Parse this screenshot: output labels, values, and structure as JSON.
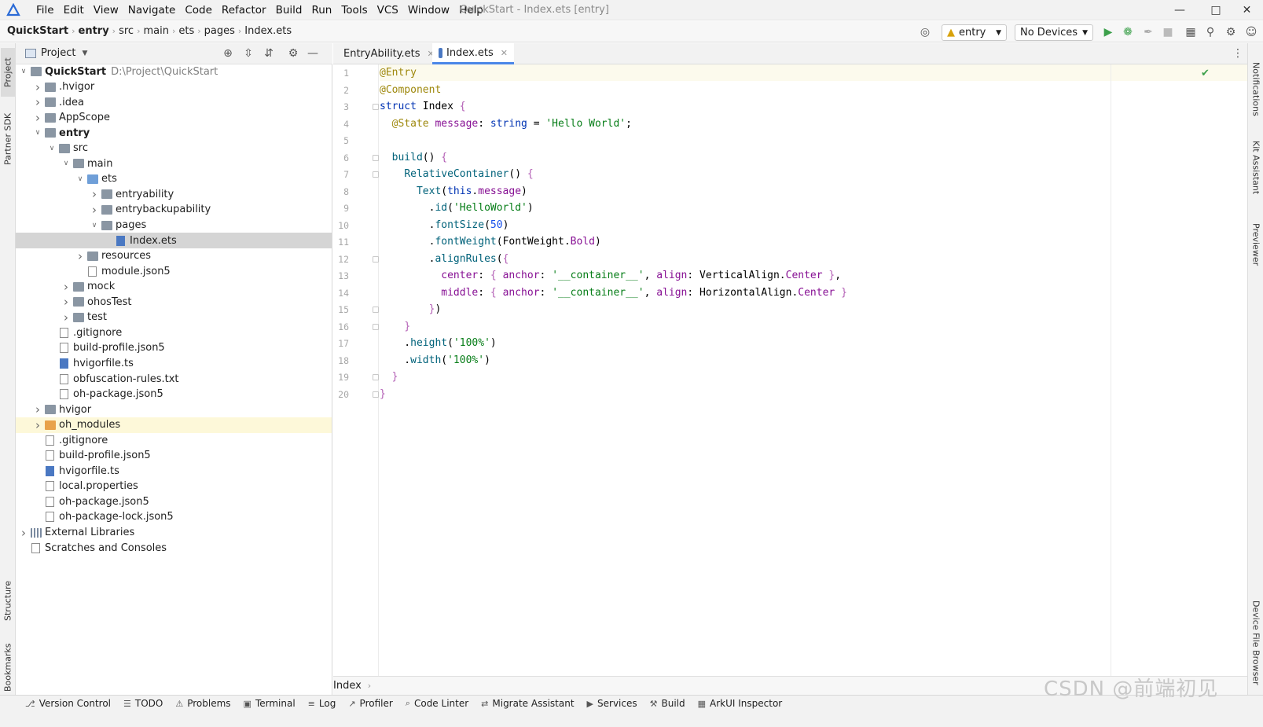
{
  "window": {
    "title": "QuickStart - Index.ets [entry]",
    "menus": [
      "File",
      "Edit",
      "View",
      "Navigate",
      "Code",
      "Refactor",
      "Build",
      "Run",
      "Tools",
      "VCS",
      "Window",
      "Help"
    ]
  },
  "navbar": {
    "crumbs": [
      "QuickStart",
      "entry",
      "src",
      "main",
      "ets",
      "pages",
      "Index.ets"
    ],
    "module_select": "entry",
    "device_select": "No Devices"
  },
  "left_strip": {
    "project": "Project",
    "partner_sdk": "Partner SDK",
    "structure": "Structure",
    "bookmarks": "Bookmarks"
  },
  "right_strip": {
    "notifications": "Notifications",
    "kit_assistant": "Kit Assistant",
    "previewer": "Previewer",
    "device_file_browser": "Device File Browser"
  },
  "project_panel": {
    "title": "Project",
    "root_path": "D:\\Project\\QuickStart",
    "tree": [
      {
        "label": "QuickStart",
        "depth": 0,
        "arrow": "v",
        "icon": "folder",
        "bold": true
      },
      {
        "label": ".hvigor",
        "depth": 1,
        "arrow": ">",
        "icon": "folder"
      },
      {
        "label": ".idea",
        "depth": 1,
        "arrow": ">",
        "icon": "folder"
      },
      {
        "label": "AppScope",
        "depth": 1,
        "arrow": ">",
        "icon": "folder"
      },
      {
        "label": "entry",
        "depth": 1,
        "arrow": "v",
        "icon": "folder",
        "bold": true
      },
      {
        "label": "src",
        "depth": 2,
        "arrow": "v",
        "icon": "folder"
      },
      {
        "label": "main",
        "depth": 3,
        "arrow": "v",
        "icon": "folder"
      },
      {
        "label": "ets",
        "depth": 4,
        "arrow": "v",
        "icon": "folder-blue"
      },
      {
        "label": "entryability",
        "depth": 5,
        "arrow": ">",
        "icon": "folder"
      },
      {
        "label": "entrybackupability",
        "depth": 5,
        "arrow": ">",
        "icon": "folder"
      },
      {
        "label": "pages",
        "depth": 5,
        "arrow": "v",
        "icon": "folder"
      },
      {
        "label": "Index.ets",
        "depth": 6,
        "arrow": "",
        "icon": "ts",
        "selected": true
      },
      {
        "label": "resources",
        "depth": 4,
        "arrow": ">",
        "icon": "folder"
      },
      {
        "label": "module.json5",
        "depth": 4,
        "arrow": "",
        "icon": "file"
      },
      {
        "label": "mock",
        "depth": 3,
        "arrow": ">",
        "icon": "folder"
      },
      {
        "label": "ohosTest",
        "depth": 3,
        "arrow": ">",
        "icon": "folder"
      },
      {
        "label": "test",
        "depth": 3,
        "arrow": ">",
        "icon": "folder"
      },
      {
        "label": ".gitignore",
        "depth": 2,
        "arrow": "",
        "icon": "file"
      },
      {
        "label": "build-profile.json5",
        "depth": 2,
        "arrow": "",
        "icon": "file"
      },
      {
        "label": "hvigorfile.ts",
        "depth": 2,
        "arrow": "",
        "icon": "ts"
      },
      {
        "label": "obfuscation-rules.txt",
        "depth": 2,
        "arrow": "",
        "icon": "file"
      },
      {
        "label": "oh-package.json5",
        "depth": 2,
        "arrow": "",
        "icon": "file"
      },
      {
        "label": "hvigor",
        "depth": 1,
        "arrow": ">",
        "icon": "folder"
      },
      {
        "label": "oh_modules",
        "depth": 1,
        "arrow": ">",
        "icon": "folder-orange",
        "highlight": true
      },
      {
        "label": ".gitignore",
        "depth": 1,
        "arrow": "",
        "icon": "file"
      },
      {
        "label": "build-profile.json5",
        "depth": 1,
        "arrow": "",
        "icon": "file"
      },
      {
        "label": "hvigorfile.ts",
        "depth": 1,
        "arrow": "",
        "icon": "ts"
      },
      {
        "label": "local.properties",
        "depth": 1,
        "arrow": "",
        "icon": "file"
      },
      {
        "label": "oh-package.json5",
        "depth": 1,
        "arrow": "",
        "icon": "file"
      },
      {
        "label": "oh-package-lock.json5",
        "depth": 1,
        "arrow": "",
        "icon": "file"
      },
      {
        "label": "External Libraries",
        "depth": 0,
        "arrow": ">",
        "icon": "lib"
      },
      {
        "label": "Scratches and Consoles",
        "depth": 0,
        "arrow": "",
        "icon": "file"
      }
    ]
  },
  "editor": {
    "tabs": [
      {
        "label": "EntryAbility.ets",
        "active": false
      },
      {
        "label": "Index.ets",
        "active": true
      }
    ],
    "lines": [
      [
        [
          "an",
          "@Entry"
        ]
      ],
      [
        [
          "an",
          "@Component"
        ]
      ],
      [
        [
          "kw",
          "struct "
        ],
        [
          "id",
          "Index "
        ],
        [
          "par",
          "{"
        ]
      ],
      [
        [
          "id",
          "  "
        ],
        [
          "an",
          "@State "
        ],
        [
          "prop",
          "message"
        ],
        [
          "id",
          ": "
        ],
        [
          "ty",
          "string "
        ],
        [
          "id",
          "= "
        ],
        [
          "str",
          "'Hello World'"
        ],
        [
          "id",
          ";"
        ]
      ],
      [
        [
          "id",
          ""
        ]
      ],
      [
        [
          "id",
          "  "
        ],
        [
          "fn",
          "build"
        ],
        [
          "id",
          "() "
        ],
        [
          "par",
          "{"
        ]
      ],
      [
        [
          "id",
          "    "
        ],
        [
          "fn",
          "RelativeContainer"
        ],
        [
          "id",
          "() "
        ],
        [
          "par",
          "{"
        ]
      ],
      [
        [
          "id",
          "      "
        ],
        [
          "fn",
          "Text"
        ],
        [
          "id",
          "("
        ],
        [
          "kw",
          "this"
        ],
        [
          "id",
          "."
        ],
        [
          "prop",
          "message"
        ],
        [
          "id",
          ")"
        ]
      ],
      [
        [
          "id",
          "        ."
        ],
        [
          "fn",
          "id"
        ],
        [
          "id",
          "("
        ],
        [
          "str",
          "'HelloWorld'"
        ],
        [
          "id",
          ")"
        ]
      ],
      [
        [
          "id",
          "        ."
        ],
        [
          "fn",
          "fontSize"
        ],
        [
          "id",
          "("
        ],
        [
          "num",
          "50"
        ],
        [
          "id",
          ")"
        ]
      ],
      [
        [
          "id",
          "        ."
        ],
        [
          "fn",
          "fontWeight"
        ],
        [
          "id",
          "("
        ],
        [
          "id",
          "FontWeight."
        ],
        [
          "prop",
          "Bold"
        ],
        [
          "id",
          ")"
        ]
      ],
      [
        [
          "id",
          "        ."
        ],
        [
          "fn",
          "alignRules"
        ],
        [
          "id",
          "("
        ],
        [
          "par",
          "{"
        ]
      ],
      [
        [
          "id",
          "          "
        ],
        [
          "prop",
          "center"
        ],
        [
          "id",
          ": "
        ],
        [
          "par",
          "{ "
        ],
        [
          "prop",
          "anchor"
        ],
        [
          "id",
          ": "
        ],
        [
          "str",
          "'__container__'"
        ],
        [
          "id",
          ", "
        ],
        [
          "prop",
          "align"
        ],
        [
          "id",
          ": "
        ],
        [
          "id",
          "VerticalAlign."
        ],
        [
          "prop",
          "Center "
        ],
        [
          "par",
          "}"
        ],
        [
          "id",
          ","
        ]
      ],
      [
        [
          "id",
          "          "
        ],
        [
          "prop",
          "middle"
        ],
        [
          "id",
          ": "
        ],
        [
          "par",
          "{ "
        ],
        [
          "prop",
          "anchor"
        ],
        [
          "id",
          ": "
        ],
        [
          "str",
          "'__container__'"
        ],
        [
          "id",
          ", "
        ],
        [
          "prop",
          "align"
        ],
        [
          "id",
          ": "
        ],
        [
          "id",
          "HorizontalAlign."
        ],
        [
          "prop",
          "Center "
        ],
        [
          "par",
          "}"
        ]
      ],
      [
        [
          "id",
          "        "
        ],
        [
          "par",
          "}"
        ],
        [
          "id",
          ")"
        ]
      ],
      [
        [
          "id",
          "    "
        ],
        [
          "par",
          "}"
        ]
      ],
      [
        [
          "id",
          "    ."
        ],
        [
          "fn",
          "height"
        ],
        [
          "id",
          "("
        ],
        [
          "str",
          "'100%'"
        ],
        [
          "id",
          ")"
        ]
      ],
      [
        [
          "id",
          "    ."
        ],
        [
          "fn",
          "width"
        ],
        [
          "id",
          "("
        ],
        [
          "str",
          "'100%'"
        ],
        [
          "id",
          ")"
        ]
      ],
      [
        [
          "id",
          "  "
        ],
        [
          "par",
          "}"
        ]
      ],
      [
        [
          "par",
          "}"
        ]
      ]
    ],
    "bottom_crumb": "Index"
  },
  "statusbar": [
    "Version Control",
    "TODO",
    "Problems",
    "Terminal",
    "Log",
    "Profiler",
    "Code Linter",
    "Migrate Assistant",
    "Services",
    "Build",
    "ArkUI Inspector"
  ],
  "watermark": "CSDN @前端初见"
}
